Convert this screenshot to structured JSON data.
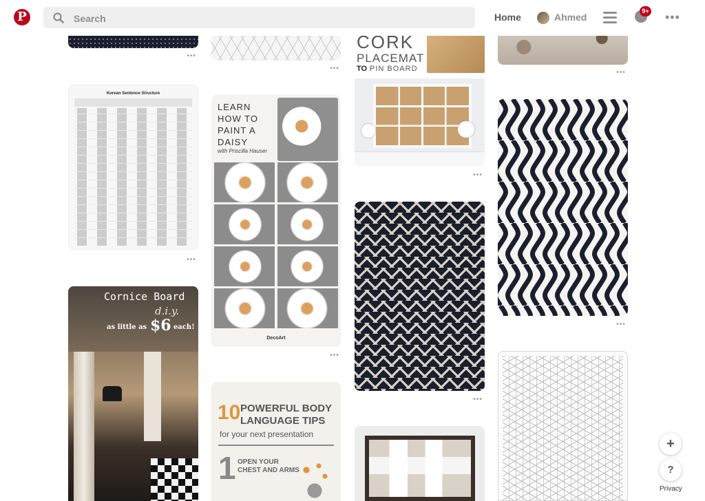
{
  "header": {
    "logo": "P",
    "search_placeholder": "Search",
    "home_label": "Home",
    "user_name": "Ahmed",
    "notification_count": "9+"
  },
  "pins": {
    "placemat": {
      "line1": "CORK",
      "line2": "PLACEMAT",
      "line3a": "TO",
      "line3b": "PIN BOARD"
    },
    "korean": {
      "title": "Korean Sentence Structure"
    },
    "daisy": {
      "line1": "LEARN",
      "line2": "HOW TO",
      "line3": "PAINT A",
      "line4": "DAISY",
      "sub": "with Priscilla Hauser",
      "brand": "DecoArt"
    },
    "cornice": {
      "line1": "Cornice Board",
      "line2": "d.i.y.",
      "line3a": "as little as",
      "line3b": "$6",
      "line3c": "each!"
    },
    "body_lang": {
      "num": "10",
      "line1": "POWERFUL BODY",
      "line2": "LANGUAGE TIPS",
      "line3": "for your next presentation",
      "tip_num": "1",
      "tip_text1": "OPEN YOUR",
      "tip_text2": "CHEST AND ARMS"
    }
  },
  "floating": {
    "add_label": "+",
    "help_label": "?",
    "privacy_label": "Privacy"
  },
  "colors": {
    "brand": "#bd081c",
    "pattern_dark": "#1b1e2e",
    "cork": "#c9a170"
  }
}
